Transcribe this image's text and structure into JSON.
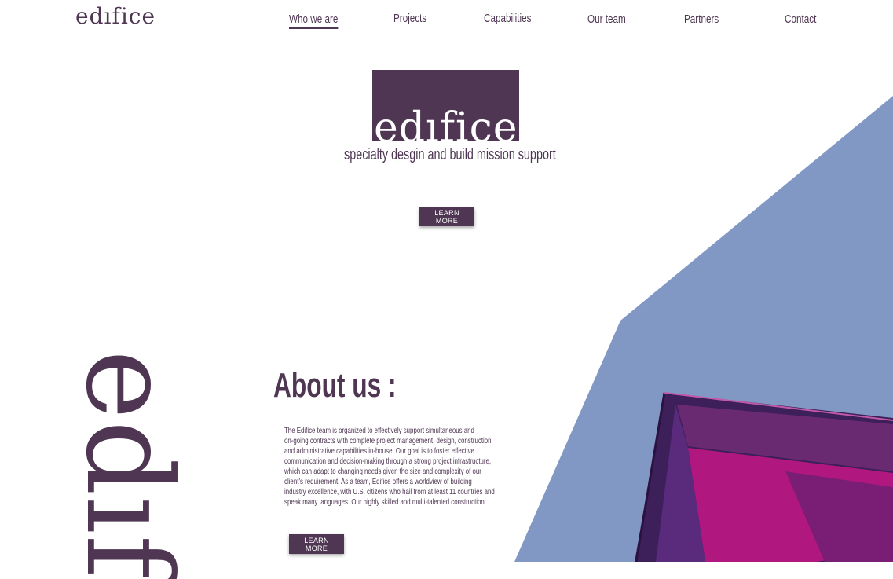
{
  "header": {
    "logo_text": "edıfice",
    "nav": [
      {
        "label": "Who we are",
        "active": true
      },
      {
        "label": "Projects",
        "active": false
      },
      {
        "label": "Capabilities",
        "active": false
      },
      {
        "label": "Our team",
        "active": false
      },
      {
        "label": "Partners",
        "active": false
      },
      {
        "label": "Contact",
        "active": false
      }
    ]
  },
  "hero": {
    "logo_text": "edıfice",
    "tagline": "specialty desgin and build mission support",
    "button_label": "LEARN MORE"
  },
  "about": {
    "vertical_word": "edıf",
    "title": "About us :",
    "body_lines": [
      "The Edifice team is organized to effectively support simultaneous and",
      "on-going contracts with complete project management, design, construction,",
      "and administrative capabilities in-house. Our goal is to foster effective",
      "communication and decision-making through a strong project infrastructure,",
      "which can adapt to changing needs given the size and complexity of our",
      "client’s requirement.  As a team, Edifice offers a worldview of building",
      "industry excellence, with U.S. citizens who hail from at least 11 countries and",
      "speak many languages.  Our highly skilled and multi-talented construction"
    ],
    "button_label": "LEARN MORE"
  },
  "colors": {
    "brand_purple": "#4f3653",
    "sky_blue": "#8298c4",
    "magenta": "#b0177f",
    "white": "#ffffff"
  }
}
